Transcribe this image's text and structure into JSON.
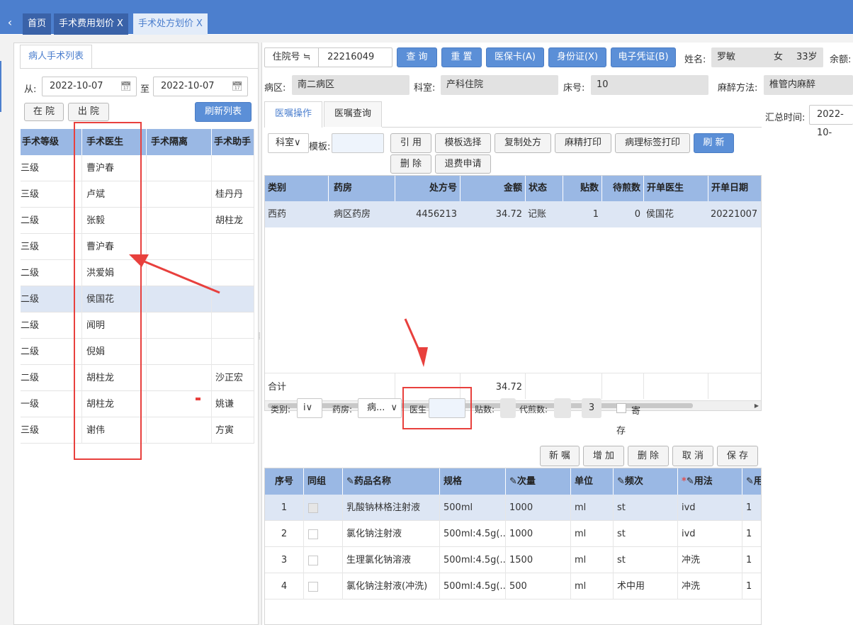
{
  "tabs": {
    "home": "首页",
    "surgery_fee": "手术费用划价",
    "surgery_rx": "手术处方划价",
    "close": "X"
  },
  "left": {
    "tab_label": "病人手术列表",
    "from_label": "从:",
    "from_date": "2022-10-07",
    "to_label": "至",
    "to_date": "2022-10-07",
    "in_hospital": "在 院",
    "discharged": "出 院",
    "refresh_list": "刷新列表",
    "columns": [
      "手术等级",
      "手术医生",
      "手术隔离",
      "手术助手"
    ],
    "rows": [
      {
        "level": "三级",
        "doctor": "曹沪春",
        "isolation": "",
        "assistant": ""
      },
      {
        "level": "三级",
        "doctor": "卢斌",
        "isolation": "",
        "assistant": "桂丹丹"
      },
      {
        "level": "二级",
        "doctor": "张毅",
        "isolation": "",
        "assistant": "胡柱龙"
      },
      {
        "level": "三级",
        "doctor": "曹沪春",
        "isolation": "",
        "assistant": ""
      },
      {
        "level": "二级",
        "doctor": "洪爱娟",
        "isolation": "",
        "assistant": ""
      },
      {
        "level": "二级",
        "doctor": "侯国花",
        "isolation": "",
        "assistant": ""
      },
      {
        "level": "二级",
        "doctor": "闻明",
        "isolation": "",
        "assistant": ""
      },
      {
        "level": "二级",
        "doctor": "倪娟",
        "isolation": "",
        "assistant": ""
      },
      {
        "level": "二级",
        "doctor": "胡柱龙",
        "isolation": "",
        "assistant": "沙正宏"
      },
      {
        "level": "一级",
        "doctor": "胡柱龙",
        "isolation": "",
        "assistant": "姚谦"
      },
      {
        "level": "三级",
        "doctor": "谢伟",
        "isolation": "",
        "assistant": "方寅"
      }
    ],
    "selected_row": 5
  },
  "patient": {
    "admission_select": "住院号 ≒",
    "admission_no": "22216049",
    "query": "查 询",
    "reset": "重 置",
    "medical_card": "医保卡(A)",
    "id_card": "身份证(X)",
    "e_voucher": "电子凭证(B)",
    "name_label": "姓名:",
    "name": "罗敏",
    "sex": "女",
    "age": "33岁",
    "balance_label": "余额:",
    "ward_label": "病区:",
    "ward": "南二病区",
    "dept_label": "科室:",
    "dept": "产科住院",
    "bed_label": "床号:",
    "bed": "10",
    "anes_label": "麻醉方法:",
    "anes": "椎管内麻醉"
  },
  "order_tabs": {
    "operate": "医嘱操作",
    "query": "医嘱查询"
  },
  "summary_time_label": "汇总时间:",
  "summary_time": "2022-10-",
  "toolbar": {
    "dept_select": "科室∨",
    "template_label": "模板:",
    "cite": "引 用",
    "template_select": "模板选择",
    "copy_rx": "复制处方",
    "narcotic_print": "麻精打印",
    "pathology_print": "病理标签打印",
    "refresh": "刷 新",
    "delete": "删 除",
    "refund": "退费申请"
  },
  "rx_grid": {
    "columns": [
      "类别",
      "药房",
      "处方号",
      "金额",
      "状态",
      "贴数",
      "待煎数",
      "开单医生",
      "开单日期"
    ],
    "rows": [
      {
        "type": "西药",
        "pharmacy": "病区药房",
        "rx_no": "4456213",
        "amount": "34.72",
        "status": "记账",
        "doses": "1",
        "pending": "0",
        "doctor": "侯国花",
        "date": "20221007"
      }
    ],
    "total_label": "合计",
    "total": "34.72"
  },
  "form": {
    "type_label": "类别:",
    "type_value": "i∨",
    "pharmacy_label": "药房:",
    "pharmacy_value": "病...",
    "pharmacy_caret": "∨",
    "doctor_label": "医生",
    "doses_label": "贴数:",
    "decoct_label": "代煎数:",
    "decoct_value": "3",
    "store_label_1": "寄",
    "store_label_2": "存"
  },
  "actions": {
    "new_order": "新 嘱",
    "add": "增 加",
    "delete": "删 除",
    "cancel": "取 消",
    "save": "保 存"
  },
  "detail_grid": {
    "columns": [
      "序号",
      "同组",
      "药品名称",
      "规格",
      "次量",
      "单位",
      "频次",
      "用法",
      "用"
    ],
    "rows": [
      {
        "seq": "1",
        "name": "乳酸钠林格注射液",
        "spec": "500ml",
        "dose": "1000",
        "unit": "ml",
        "freq": "st",
        "usage": "ivd",
        "qty": "1"
      },
      {
        "seq": "2",
        "name": "氯化钠注射液",
        "spec": "500ml:4.5g(...",
        "dose": "1000",
        "unit": "ml",
        "freq": "st",
        "usage": "ivd",
        "qty": "1"
      },
      {
        "seq": "3",
        "name": "生理氯化钠溶液",
        "spec": "500ml:4.5g(...",
        "dose": "1500",
        "unit": "ml",
        "freq": "st",
        "usage": "冲洗",
        "qty": "1"
      },
      {
        "seq": "4",
        "name": "氯化钠注射液(冲洗)",
        "spec": "500ml:4.5g(...",
        "dose": "500",
        "unit": "ml",
        "freq": "术中用",
        "usage": "冲洗",
        "qty": "1"
      }
    ],
    "selected_row": 0
  },
  "colors": {
    "accent": "#4c7fce",
    "header": "#9ab8e4",
    "button": "#5b8fd7",
    "annotation": "#e8403d"
  }
}
